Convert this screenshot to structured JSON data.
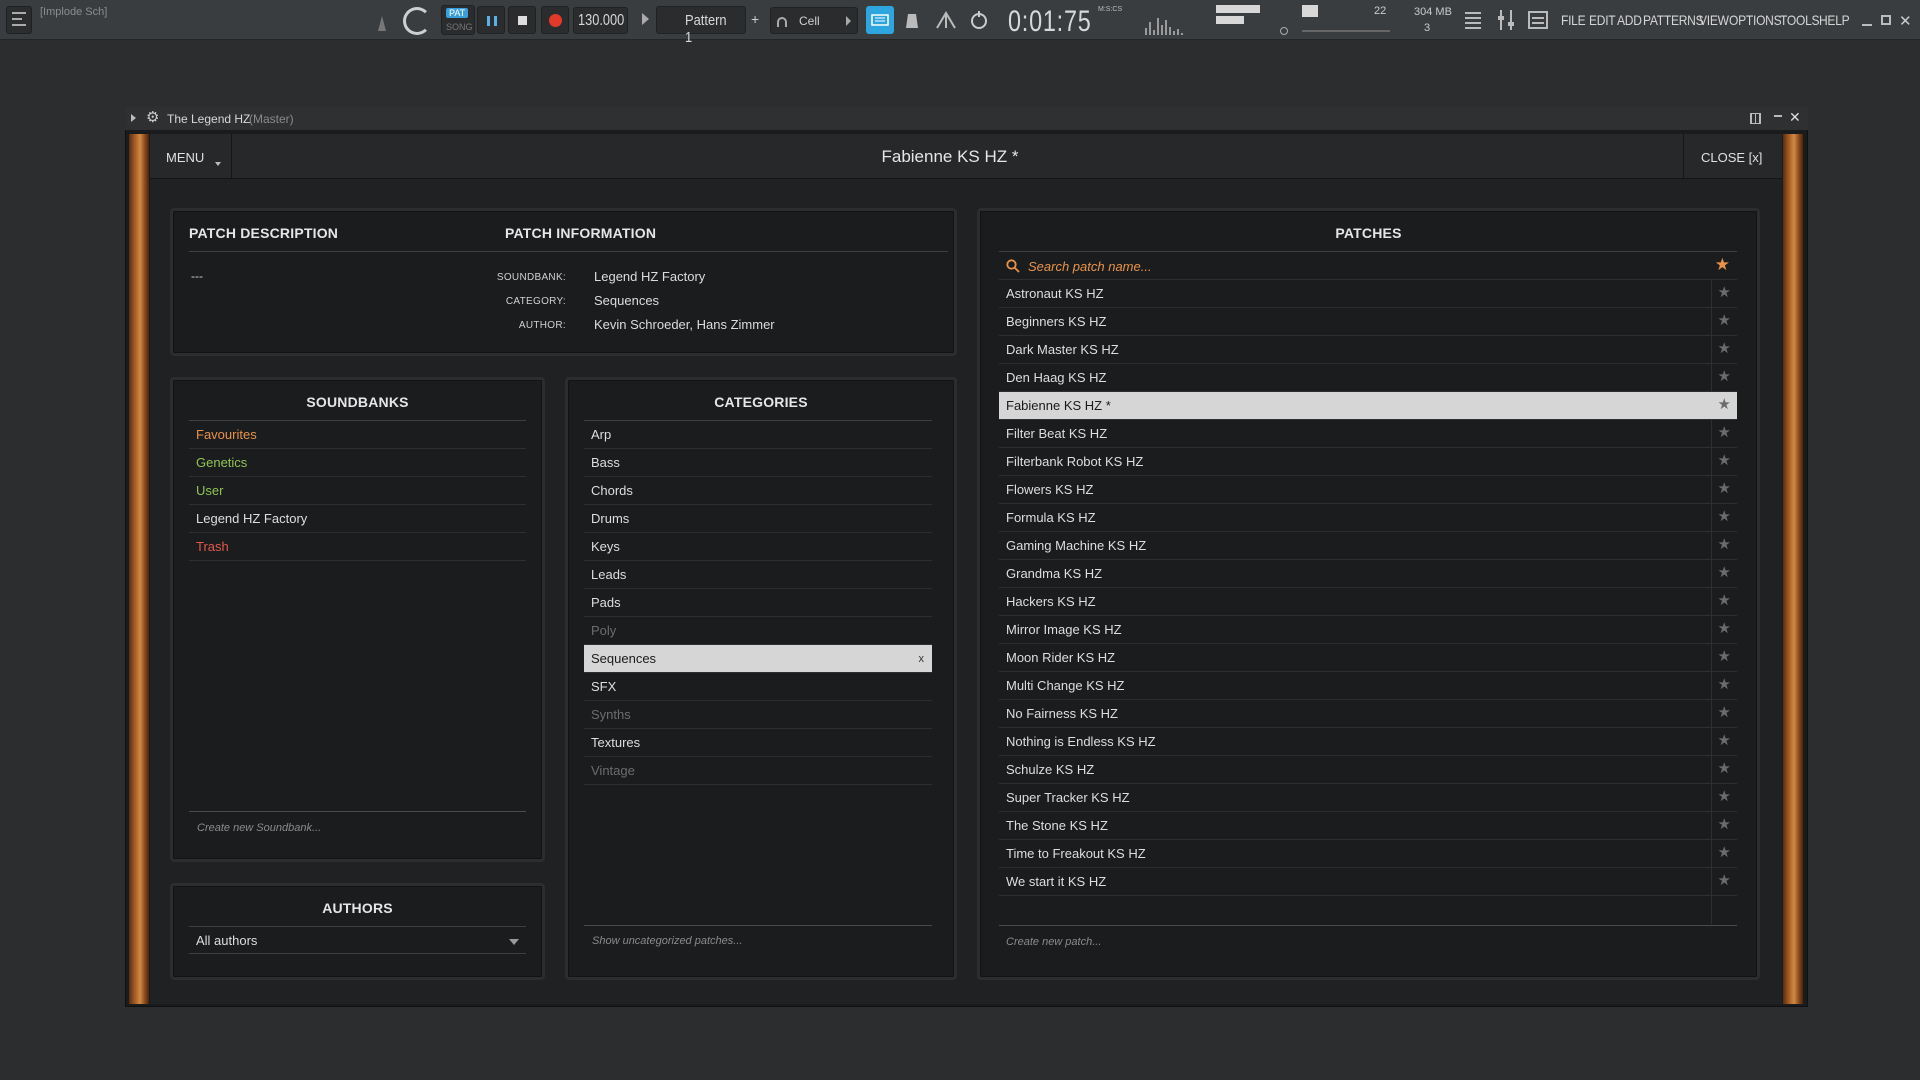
{
  "toolbar": {
    "project_hint": "[Implode Sch]",
    "pat_label": "PAT",
    "song_label": "SONG",
    "tempo": "130.000",
    "pattern": "Pattern 1",
    "snap": "Cell",
    "time": "0:01:75",
    "time_unit": "M:S:CS",
    "cpu_value": "22",
    "memory": "304 MB",
    "polyphony": "3",
    "menu": [
      "FILE",
      "EDIT",
      "ADD",
      "PATTERNS",
      "VIEW",
      "OPTIONS",
      "TOOLS",
      "HELP"
    ]
  },
  "window": {
    "title": "The Legend HZ",
    "title_suffix": "(Master)"
  },
  "plugin": {
    "menu_label": "MENU",
    "patch_title": "Fabienne KS HZ *",
    "close_label": "CLOSE [x]",
    "patch_description": {
      "header": "PATCH DESCRIPTION",
      "text": "---"
    },
    "patch_information": {
      "header": "PATCH INFORMATION",
      "soundbank_label": "SOUNDBANK:",
      "soundbank": "Legend HZ Factory",
      "category_label": "CATEGORY:",
      "category": "Sequences",
      "author_label": "AUTHOR:",
      "author": "Kevin Schroeder, Hans Zimmer"
    },
    "soundbanks": {
      "header": "SOUNDBANKS",
      "items": [
        {
          "label": "Favourites",
          "color": "#e8934a"
        },
        {
          "label": "Genetics",
          "color": "#8fc454"
        },
        {
          "label": "User",
          "color": "#8fc454"
        },
        {
          "label": "Legend HZ Factory",
          "color": "#dedede"
        },
        {
          "label": "Trash",
          "color": "#e0584a"
        }
      ],
      "create_placeholder": "Create new Soundbank..."
    },
    "authors": {
      "header": "AUTHORS",
      "selected": "All authors"
    },
    "categories": {
      "header": "CATEGORIES",
      "items": [
        "Arp",
        "Bass",
        "Chords",
        "Drums",
        "Keys",
        "Leads",
        "Pads",
        "Poly",
        "Sequences",
        "SFX",
        "Synths",
        "Textures",
        "Vintage"
      ],
      "dim": [
        "Poly",
        "Synths",
        "Vintage"
      ],
      "selected": "Sequences",
      "clear_label": "x",
      "footer": "Show uncategorized patches..."
    },
    "patches": {
      "header": "PATCHES",
      "search_placeholder": "Search patch name...",
      "items": [
        "Astronaut KS HZ",
        "Beginners KS HZ",
        "Dark Master KS HZ",
        "Den Haag KS HZ",
        "Fabienne KS HZ *",
        "Filter Beat KS HZ",
        "Filterbank Robot KS HZ",
        "Flowers KS HZ",
        "Formula KS HZ",
        "Gaming Machine KS HZ",
        "Grandma KS HZ",
        "Hackers KS HZ",
        "Mirror Image KS HZ",
        "Moon Rider KS HZ",
        "Multi Change KS HZ",
        "No Fairness KS HZ",
        "Nothing is Endless KS HZ",
        "Schulze KS HZ",
        "Super Tracker KS HZ",
        "The Stone KS HZ",
        "Time to Freakout KS HZ",
        "We start it KS HZ"
      ],
      "selected": "Fabienne KS HZ *",
      "create_placeholder": "Create new patch..."
    },
    "colors": {
      "accent_orange": "#e8934a",
      "selected_row_bg": "#d6d6d6"
    }
  }
}
